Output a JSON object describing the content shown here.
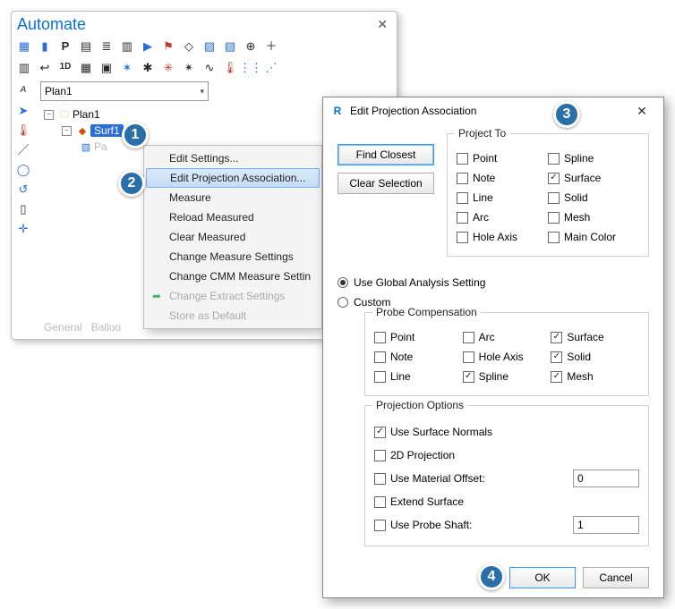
{
  "panel": {
    "title": "Automate"
  },
  "plan_select": "Plan1",
  "tree": {
    "plan": "Plan1",
    "surf": "Surf1",
    "pa": "Pa"
  },
  "tabs": {
    "general": "General",
    "balloon": "Balloo"
  },
  "ctx": {
    "items": [
      "Edit Settings...",
      "Edit Projection Association...",
      "Measure",
      "Reload Measured",
      "Clear Measured",
      "Change Measure Settings",
      "Change CMM Measure Settin",
      "Change Extract Settings",
      "Store as Default"
    ]
  },
  "dialog": {
    "title": "Edit Projection Association",
    "find_closest": "Find Closest",
    "clear_selection": "Clear Selection",
    "project_to": {
      "legend": "Project To",
      "point": "Point",
      "note": "Note",
      "line": "Line",
      "arc": "Arc",
      "hole_axis": "Hole Axis",
      "spline": "Spline",
      "surface": "Surface",
      "solid": "Solid",
      "mesh": "Mesh",
      "main_color": "Main Color"
    },
    "use_global": "Use Global Analysis Setting",
    "custom": "Custom",
    "probe_comp": {
      "legend": "Probe Compensation",
      "point": "Point",
      "note": "Note",
      "line": "Line",
      "arc": "Arc",
      "hole_axis": "Hole Axis",
      "spline": "Spline",
      "surface": "Surface",
      "solid": "Solid",
      "mesh": "Mesh"
    },
    "proj_opts": {
      "legend": "Projection Options",
      "use_surface_normals": "Use Surface Normals",
      "two_d": "2D Projection",
      "material_offset": "Use Material Offset:",
      "material_offset_val": "0",
      "extend_surface": "Extend Surface",
      "probe_shaft": "Use Probe Shaft:",
      "probe_shaft_val": "1"
    },
    "ok": "OK",
    "cancel": "Cancel"
  },
  "steps": {
    "s1": "1",
    "s2": "2",
    "s3": "3",
    "s4": "4"
  }
}
